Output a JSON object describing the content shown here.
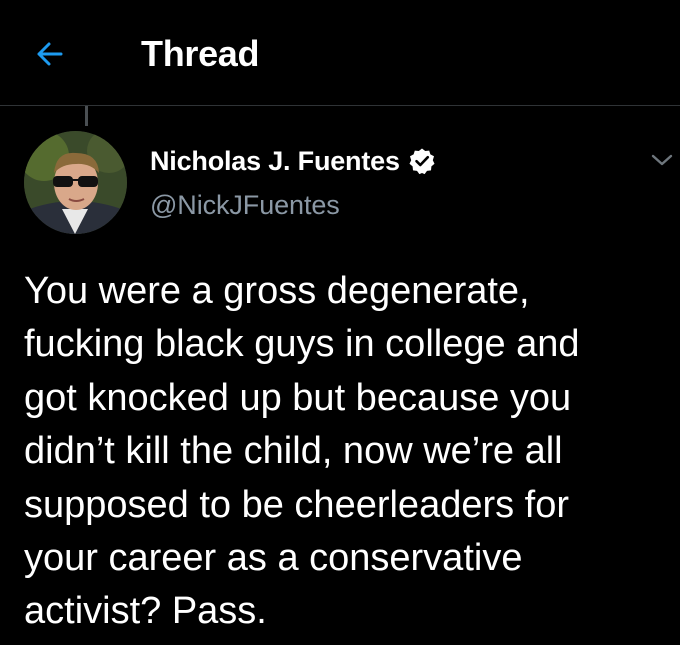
{
  "header": {
    "back_icon": "arrow-left-icon",
    "title": "Thread"
  },
  "colors": {
    "background": "#000000",
    "accent": "#1d9bf0",
    "secondary_text": "#8b98a5",
    "divider": "#2f3336"
  },
  "tweet": {
    "author": {
      "display_name": "Nicholas J. Fuentes",
      "handle": "@NickJFuentes",
      "verified": true,
      "verified_icon": "verified-badge-icon"
    },
    "more_icon": "chevron-down-icon",
    "text": "You were a gross degenerate,\nfucking black guys in college and\ngot knocked up but because you\ndidn’t kill the child, now we’re all\nsupposed to be cheerleaders for\nyour career as a conservative\nactivist? Pass."
  }
}
